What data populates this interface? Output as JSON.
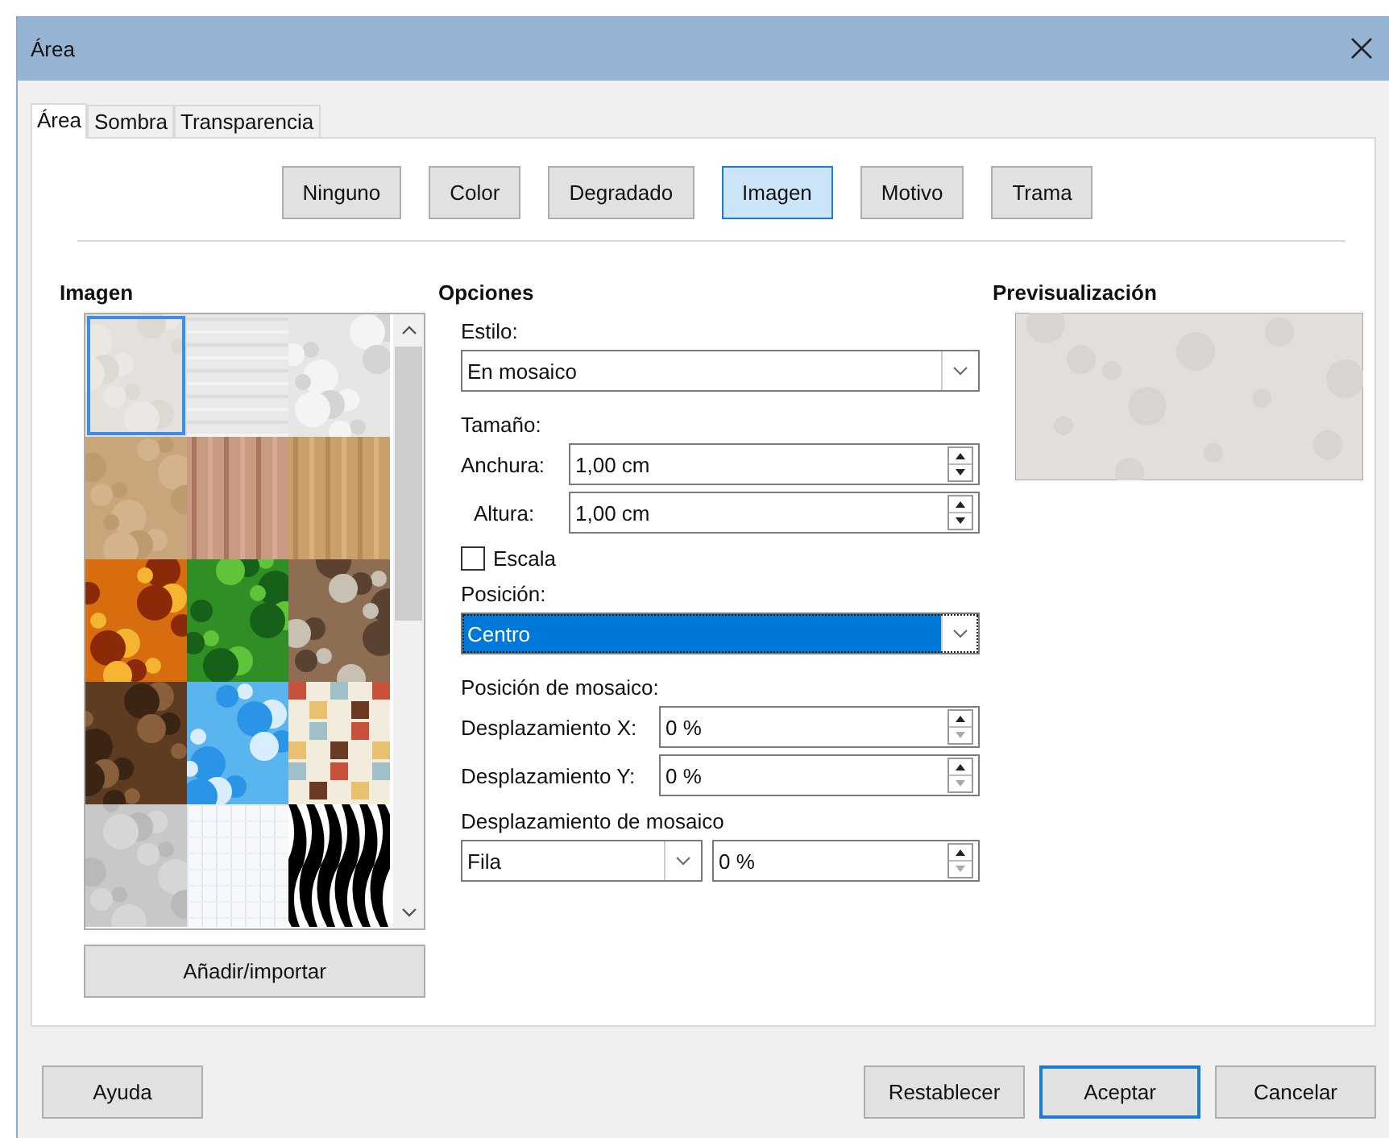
{
  "window": {
    "title": "Área"
  },
  "tabs": [
    {
      "label": "Área",
      "selected": true
    },
    {
      "label": "Sombra",
      "selected": false
    },
    {
      "label": "Transparencia",
      "selected": false
    }
  ],
  "fill_types": [
    {
      "label": "Ninguno",
      "selected": false
    },
    {
      "label": "Color",
      "selected": false
    },
    {
      "label": "Degradado",
      "selected": false
    },
    {
      "label": "Imagen",
      "selected": true
    },
    {
      "label": "Motivo",
      "selected": false
    },
    {
      "label": "Trama",
      "selected": false
    }
  ],
  "image_panel": {
    "heading": "Imagen",
    "tiles": [
      {
        "kind": "picture",
        "selected": true
      },
      {
        "kind": "picture",
        "selected": false
      },
      {
        "kind": "picture",
        "selected": false
      },
      {
        "kind": "picture",
        "selected": false
      },
      {
        "kind": "picture",
        "selected": false
      },
      {
        "kind": "picture",
        "selected": false
      },
      {
        "kind": "picture",
        "selected": false
      },
      {
        "kind": "picture",
        "selected": false
      },
      {
        "kind": "picture",
        "selected": false
      },
      {
        "kind": "picture",
        "selected": false
      },
      {
        "kind": "picture",
        "selected": false
      },
      {
        "kind": "picture",
        "selected": false
      },
      {
        "kind": "picture",
        "selected": false
      },
      {
        "kind": "picture",
        "selected": false
      },
      {
        "kind": "picture",
        "selected": false
      }
    ],
    "add_button": "Añadir/importar"
  },
  "options": {
    "heading": "Opciones",
    "style": {
      "label": "Estilo:",
      "value": "En mosaico"
    },
    "size": {
      "label": "Tamaño:",
      "width": {
        "label": "Anchura:",
        "value": "1,00 cm"
      },
      "height": {
        "label": "Altura:",
        "value": "1,00 cm"
      },
      "scale": {
        "label": "Escala",
        "checked": false
      }
    },
    "position": {
      "label": "Posición:",
      "value": "Centro",
      "focused": true
    },
    "tile_position": {
      "label": "Posición de mosaico:",
      "offset_x": {
        "label": "Desplazamiento X:",
        "value": "0 %"
      },
      "offset_y": {
        "label": "Desplazamiento Y:",
        "value": "0 %"
      }
    },
    "tile_offset": {
      "label": "Desplazamiento de mosaico",
      "mode": "Fila",
      "value": "0 %"
    }
  },
  "preview": {
    "heading": "Previsualización"
  },
  "buttons_left": [
    {
      "label": "Ayuda",
      "default": false
    }
  ],
  "buttons_right": [
    {
      "label": "Restablecer",
      "default": false
    },
    {
      "label": "Aceptar",
      "default": true
    },
    {
      "label": "Cancelar",
      "default": false
    }
  ]
}
